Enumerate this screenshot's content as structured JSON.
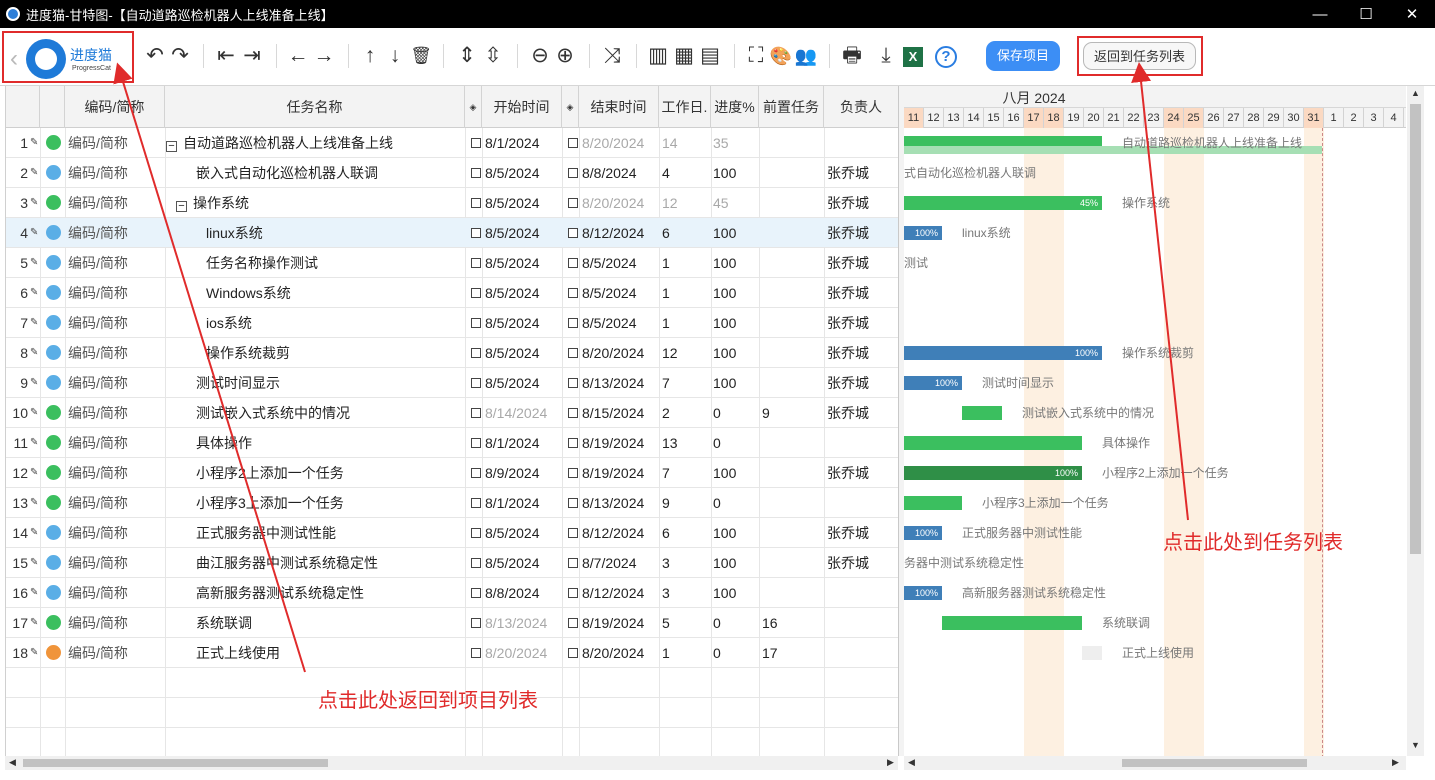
{
  "window": {
    "title": "进度猫-甘特图-【自动道路巡检机器人上线准备上线】",
    "controls": [
      "—",
      "☐",
      "✕"
    ]
  },
  "logo": {
    "back": "‹",
    "name": "进度猫",
    "sub": "ProgressCat"
  },
  "toolbar": {
    "undo": "↶",
    "redo": "↷",
    "outdent": "⇤",
    "indent": "⇥",
    "move_left": "←",
    "move_right": "→",
    "move_up": "↑",
    "move_down": "↓",
    "delete": "🗑",
    "expand": "⇕",
    "collapse": "⇳",
    "zoom_out": "⊖",
    "zoom_in": "⊕",
    "link": "⤨",
    "layout_left": "▥",
    "layout_split": "▦",
    "layout_right": "▤",
    "fullscreen": "⛶",
    "theme": "🎨",
    "people": "👥",
    "print": "🖶",
    "download": "⤓",
    "excel": "X",
    "help": "?",
    "save_label": "保存项目",
    "return_label": "返回到任务列表"
  },
  "grid": {
    "headers": {
      "code": "编码/简称",
      "name": "任务名称",
      "start": "开始时间",
      "end": "结束时间",
      "duration": "工作日.",
      "progress": "进度%",
      "predecessor": "前置任务",
      "owner": "负责人"
    },
    "rows": [
      {
        "n": "1",
        "color": "#3bbf5f",
        "code": "编码/简称",
        "name": "自动道路巡检机器人上线准备上线",
        "indent": 0,
        "toggle": "−",
        "start": "8/1/2024",
        "end": "8/20/2024",
        "dur": "14",
        "prog": "35",
        "pre": "",
        "owner": "",
        "endGray": true,
        "durGray": true
      },
      {
        "n": "2",
        "color": "#5aaee6",
        "code": "编码/简称",
        "name": "嵌入式自动化巡检机器人联调",
        "indent": 1,
        "toggle": "",
        "start": "8/5/2024",
        "end": "8/8/2024",
        "dur": "4",
        "prog": "100",
        "pre": "",
        "owner": "张乔城"
      },
      {
        "n": "3",
        "color": "#3bbf5f",
        "code": "编码/简称",
        "name": "操作系统",
        "indent": 1,
        "toggle": "−",
        "start": "8/5/2024",
        "end": "8/20/2024",
        "dur": "12",
        "prog": "45",
        "pre": "",
        "owner": "张乔城",
        "endGray": true,
        "durGray": true
      },
      {
        "n": "4",
        "color": "#5aaee6",
        "code": "编码/简称",
        "name": "linux系统",
        "indent": 2,
        "toggle": "",
        "start": "8/5/2024",
        "end": "8/12/2024",
        "dur": "6",
        "prog": "100",
        "pre": "",
        "owner": "张乔城",
        "sel": true
      },
      {
        "n": "5",
        "color": "#5aaee6",
        "code": "编码/简称",
        "name": "任务名称操作测试",
        "indent": 2,
        "toggle": "",
        "start": "8/5/2024",
        "end": "8/5/2024",
        "dur": "1",
        "prog": "100",
        "pre": "",
        "owner": "张乔城"
      },
      {
        "n": "6",
        "color": "#5aaee6",
        "code": "编码/简称",
        "name": "Windows系统",
        "indent": 2,
        "toggle": "",
        "start": "8/5/2024",
        "end": "8/5/2024",
        "dur": "1",
        "prog": "100",
        "pre": "",
        "owner": "张乔城"
      },
      {
        "n": "7",
        "color": "#5aaee6",
        "code": "编码/简称",
        "name": "ios系统",
        "indent": 2,
        "toggle": "",
        "start": "8/5/2024",
        "end": "8/5/2024",
        "dur": "1",
        "prog": "100",
        "pre": "",
        "owner": "张乔城"
      },
      {
        "n": "8",
        "color": "#5aaee6",
        "code": "编码/简称",
        "name": "操作系统裁剪",
        "indent": 2,
        "toggle": "",
        "start": "8/5/2024",
        "end": "8/20/2024",
        "dur": "12",
        "prog": "100",
        "pre": "",
        "owner": "张乔城"
      },
      {
        "n": "9",
        "color": "#5aaee6",
        "code": "编码/简称",
        "name": "测试时间显示",
        "indent": 1,
        "toggle": "",
        "start": "8/5/2024",
        "end": "8/13/2024",
        "dur": "7",
        "prog": "100",
        "pre": "",
        "owner": "张乔城"
      },
      {
        "n": "10",
        "color": "#3bbf5f",
        "code": "编码/简称",
        "name": "测试嵌入式系统中的情况",
        "indent": 1,
        "toggle": "",
        "start": "8/14/2024",
        "end": "8/15/2024",
        "dur": "2",
        "prog": "0",
        "pre": "9",
        "owner": "张乔城",
        "startGray": true
      },
      {
        "n": "11",
        "color": "#3bbf5f",
        "code": "编码/简称",
        "name": "具体操作",
        "indent": 1,
        "toggle": "",
        "start": "8/1/2024",
        "end": "8/19/2024",
        "dur": "13",
        "prog": "0",
        "pre": "",
        "owner": ""
      },
      {
        "n": "12",
        "color": "#3bbf5f",
        "code": "编码/简称",
        "name": "小程序2上添加一个任务",
        "indent": 1,
        "toggle": "",
        "start": "8/9/2024",
        "end": "8/19/2024",
        "dur": "7",
        "prog": "100",
        "pre": "",
        "owner": "张乔城"
      },
      {
        "n": "13",
        "color": "#3bbf5f",
        "code": "编码/简称",
        "name": "小程序3上添加一个任务",
        "indent": 1,
        "toggle": "",
        "start": "8/1/2024",
        "end": "8/13/2024",
        "dur": "9",
        "prog": "0",
        "pre": "",
        "owner": ""
      },
      {
        "n": "14",
        "color": "#5aaee6",
        "code": "编码/简称",
        "name": "正式服务器中测试性能",
        "indent": 1,
        "toggle": "",
        "start": "8/5/2024",
        "end": "8/12/2024",
        "dur": "6",
        "prog": "100",
        "pre": "",
        "owner": "张乔城"
      },
      {
        "n": "15",
        "color": "#5aaee6",
        "code": "编码/简称",
        "name": "曲江服务器中测试系统稳定性",
        "indent": 1,
        "toggle": "",
        "start": "8/5/2024",
        "end": "8/7/2024",
        "dur": "3",
        "prog": "100",
        "pre": "",
        "owner": "张乔城"
      },
      {
        "n": "16",
        "color": "#5aaee6",
        "code": "编码/简称",
        "name": "高新服务器测试系统稳定性",
        "indent": 1,
        "toggle": "",
        "start": "8/8/2024",
        "end": "8/12/2024",
        "dur": "3",
        "prog": "100",
        "pre": "",
        "owner": ""
      },
      {
        "n": "17",
        "color": "#3bbf5f",
        "code": "编码/简称",
        "name": "系统联调",
        "indent": 1,
        "toggle": "",
        "start": "8/13/2024",
        "end": "8/19/2024",
        "dur": "5",
        "prog": "0",
        "pre": "16",
        "owner": "",
        "startGray": true
      },
      {
        "n": "18",
        "color": "#f0943a",
        "code": "编码/简称",
        "name": "正式上线使用",
        "indent": 1,
        "toggle": "",
        "start": "8/20/2024",
        "end": "8/20/2024",
        "dur": "1",
        "prog": "0",
        "pre": "17",
        "owner": "",
        "startGray": true
      }
    ]
  },
  "gantt": {
    "month": "八月 2024",
    "days": [
      "11",
      "12",
      "13",
      "14",
      "15",
      "16",
      "17",
      "18",
      "19",
      "20",
      "21",
      "22",
      "23",
      "24",
      "25",
      "26",
      "27",
      "28",
      "29",
      "30",
      "31",
      "1",
      "2",
      "3",
      "4"
    ],
    "weekend_days": [
      "11",
      "17",
      "18",
      "24",
      "25",
      "31"
    ],
    "bar_labels": [
      {
        "row": 0,
        "text": "自动道路巡检机器人上线准备上线"
      },
      {
        "row": 1,
        "text": "式自动化巡检机器人联调"
      },
      {
        "row": 2,
        "text": "操作系统"
      },
      {
        "row": 3,
        "text": "linux系统"
      },
      {
        "row": 4,
        "text": "测试"
      },
      {
        "row": 7,
        "text": "操作系统裁剪"
      },
      {
        "row": 8,
        "text": "测试时间显示"
      },
      {
        "row": 9,
        "text": "测试嵌入式系统中的情况"
      },
      {
        "row": 10,
        "text": "具体操作"
      },
      {
        "row": 11,
        "text": "小程序2上添加一个任务"
      },
      {
        "row": 12,
        "text": "小程序3上添加一个任务"
      },
      {
        "row": 13,
        "text": "正式服务器中测试性能"
      },
      {
        "row": 14,
        "text": "务器中测试系统稳定性"
      },
      {
        "row": 15,
        "text": "高新服务器测试系统稳定性"
      },
      {
        "row": 16,
        "text": "系统联调"
      },
      {
        "row": 17,
        "text": "正式上线使用"
      }
    ],
    "pct": {
      "r3": "45%",
      "r4": "100%",
      "r8": "100%",
      "r9": "100%",
      "r12": "100%",
      "r14": "100%",
      "r16": "100%"
    }
  },
  "annotations": {
    "left": "点击此处返回到项目列表",
    "right": "点击此处到任务列表"
  }
}
